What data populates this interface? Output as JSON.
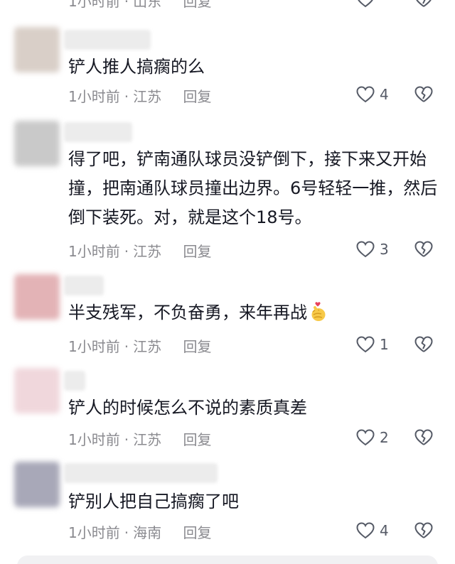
{
  "top_partial": {
    "time": "1小时前",
    "location": "山东",
    "reply_label": "回复"
  },
  "comments": [
    {
      "text": "铲人推人搞瘸的么",
      "time": "1小时前",
      "location": "江苏",
      "reply_label": "回复",
      "likes": "4"
    },
    {
      "text": "得了吧，铲南通队球员没铲倒下，接下来又开始撞，把南通队球员撞出边界。6号轻轻一推，然后倒下装死。对，就是这个18号。",
      "time": "1小时前",
      "location": "江苏",
      "reply_label": "回复",
      "likes": "3"
    },
    {
      "text": "半支残军，不负奋勇，来年再战",
      "emoji": "finger-heart-emoji",
      "time": "1小时前",
      "location": "江苏",
      "reply_label": "回复",
      "likes": "1"
    },
    {
      "text": "铲人的时候怎么不说的素质真差",
      "time": "1小时前",
      "location": "江苏",
      "reply_label": "回复",
      "likes": "2"
    },
    {
      "text": "铲别人把自己搞瘸了吧",
      "time": "1小时前",
      "location": "海南",
      "reply_label": "回复",
      "likes": "4"
    }
  ],
  "colors": {
    "text": "#161823",
    "meta": "#8a8a8f",
    "icon": "#555a66",
    "heart_emoji": "#e8405a",
    "hand_emoji": "#f7c948"
  }
}
